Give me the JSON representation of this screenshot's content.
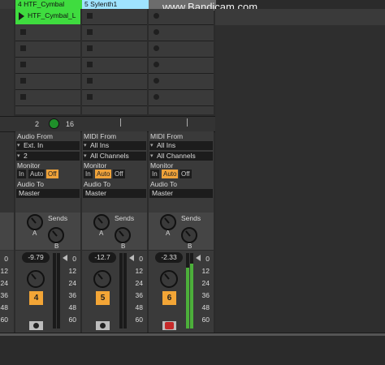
{
  "watermark": "www.Bandicam.com",
  "tracks": [
    {
      "id": "4",
      "name": "4 HTF_Cymbal",
      "clip_name": "HTF_Cymbal_L",
      "io_section": "Audio From",
      "input_type": "Ext. In",
      "input_channel": "2",
      "monitor_label": "Monitor",
      "monitor_options": [
        "In",
        "Auto",
        "Off"
      ],
      "monitor_active": "Off",
      "audio_to_label": "Audio To",
      "audio_to": "Master",
      "sends_label": "Sends",
      "send_a": "A",
      "send_b": "B",
      "volume": "-9.79",
      "number": "4"
    },
    {
      "id": "5",
      "name": "5 Sylenth1",
      "io_section": "MIDI From",
      "input_type": "All Ins",
      "input_channel": "All Channels",
      "monitor_label": "Monitor",
      "monitor_options": [
        "In",
        "Auto",
        "Off"
      ],
      "monitor_active": "Auto",
      "audio_to_label": "Audio To",
      "audio_to": "Master",
      "sends_label": "Sends",
      "send_a": "A",
      "send_b": "B",
      "volume": "-12.7",
      "number": "5"
    },
    {
      "id": "6",
      "name": "",
      "io_section": "MIDI From",
      "input_type": "All Ins",
      "input_channel": "All Channels",
      "monitor_label": "Monitor",
      "monitor_options": [
        "In",
        "Auto",
        "Off"
      ],
      "monitor_active": "Auto",
      "audio_to_label": "Audio To",
      "audio_to": "Master",
      "sends_label": "Sends",
      "send_a": "A",
      "send_b": "B",
      "volume": "-2.33",
      "number": "6"
    }
  ],
  "group_row": {
    "left_value": "2",
    "right_value": "16"
  },
  "meter_scale": [
    "0",
    "12",
    "24",
    "36",
    "48",
    "60"
  ],
  "colors": {
    "track4": "#3fdc3f",
    "track5": "#9fe3ff",
    "accent": "#f3a536",
    "meter_green": "#4caf3a"
  }
}
